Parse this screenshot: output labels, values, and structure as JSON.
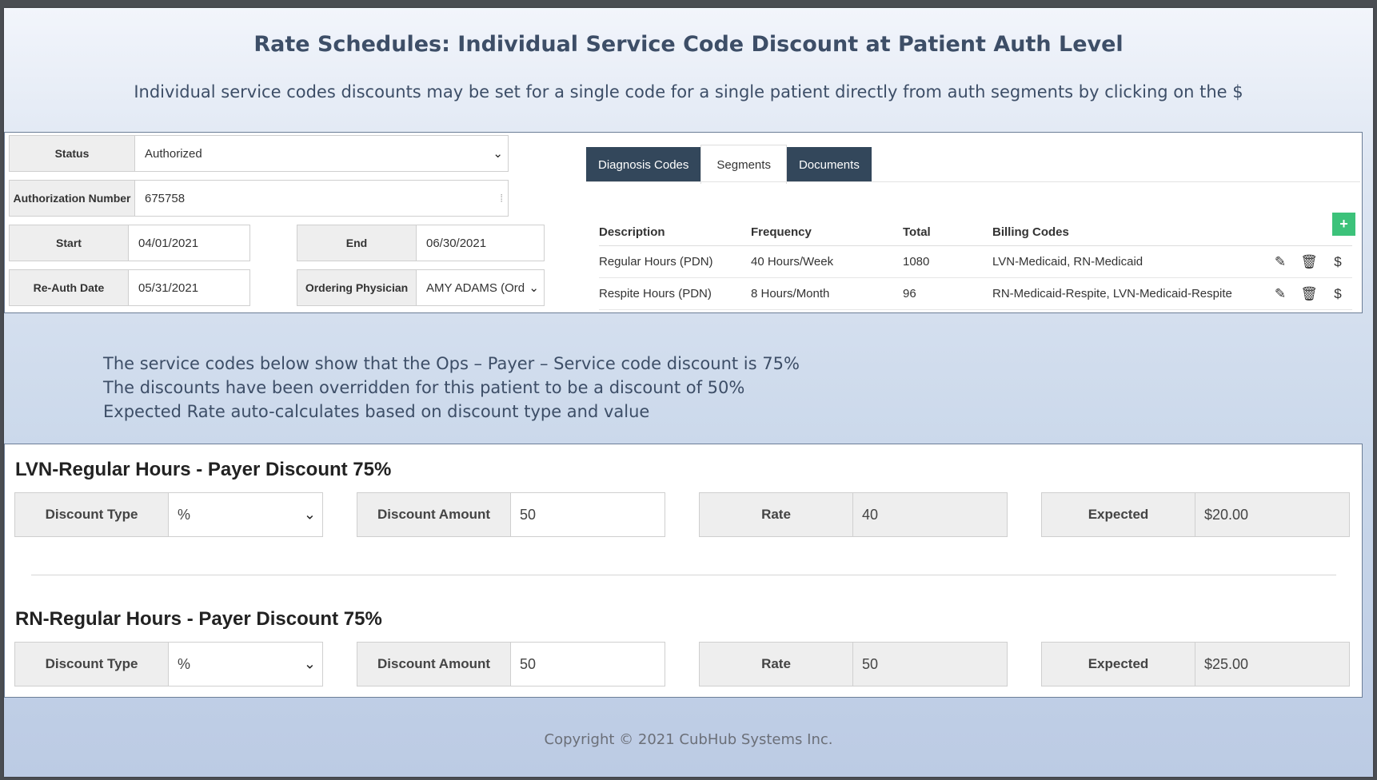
{
  "title": "Rate Schedules: Individual Service Code Discount at Patient Auth Level",
  "subtitle": "Individual service codes discounts may be set for a single code for a single patient directly from auth segments by clicking on the $",
  "auth_form": {
    "status_label": "Status",
    "status_value": "Authorized",
    "auth_number_label": "Authorization Number",
    "auth_number_value": "675758",
    "start_label": "Start",
    "start_value": "04/01/2021",
    "end_label": "End",
    "end_value": "06/30/2021",
    "reauth_label": "Re-Auth Date",
    "reauth_value": "05/31/2021",
    "physician_label": "Ordering Physician",
    "physician_value": "AMY ADAMS (Ord"
  },
  "tabs": [
    {
      "label": "Diagnosis Codes"
    },
    {
      "label": "Segments"
    },
    {
      "label": "Documents"
    }
  ],
  "segments": {
    "headers": [
      "Description",
      "Frequency",
      "Total",
      "Billing Codes"
    ],
    "add_label": "+",
    "rows": [
      {
        "description": "Regular Hours (PDN)",
        "frequency": "40 Hours/Week",
        "total": "1080",
        "billing_codes": "LVN-Medicaid, RN-Medicaid"
      },
      {
        "description": "Respite Hours (PDN)",
        "frequency": "8 Hours/Month",
        "total": "96",
        "billing_codes": "RN-Medicaid-Respite, LVN-Medicaid-Respite"
      }
    ],
    "dollar_label": "$"
  },
  "notes": [
    "The service codes below show that the Ops – Payer – Service code discount is 75%",
    "The discounts have been overridden for this patient to be a discount of 50%",
    "Expected Rate auto-calculates based on discount type and value"
  ],
  "discounts": [
    {
      "title": "LVN-Regular Hours - Payer Discount 75%",
      "type_label": "Discount Type",
      "type_value": "%",
      "amount_label": "Discount Amount",
      "amount_value": "50",
      "rate_label": "Rate",
      "rate_value": "40",
      "expected_label": "Expected",
      "expected_value": "$20.00"
    },
    {
      "title": "RN-Regular Hours - Payer Discount 75%",
      "type_label": "Discount Type",
      "type_value": "%",
      "amount_label": "Discount Amount",
      "amount_value": "50",
      "rate_label": "Rate",
      "rate_value": "50",
      "expected_label": "Expected",
      "expected_value": "$25.00"
    }
  ],
  "copyright": "Copyright © 2021 CubHub Systems Inc.",
  "colors": {
    "tab_dark": "#33475b",
    "add_button": "#3cc27a",
    "heading": "#3d4e67"
  }
}
